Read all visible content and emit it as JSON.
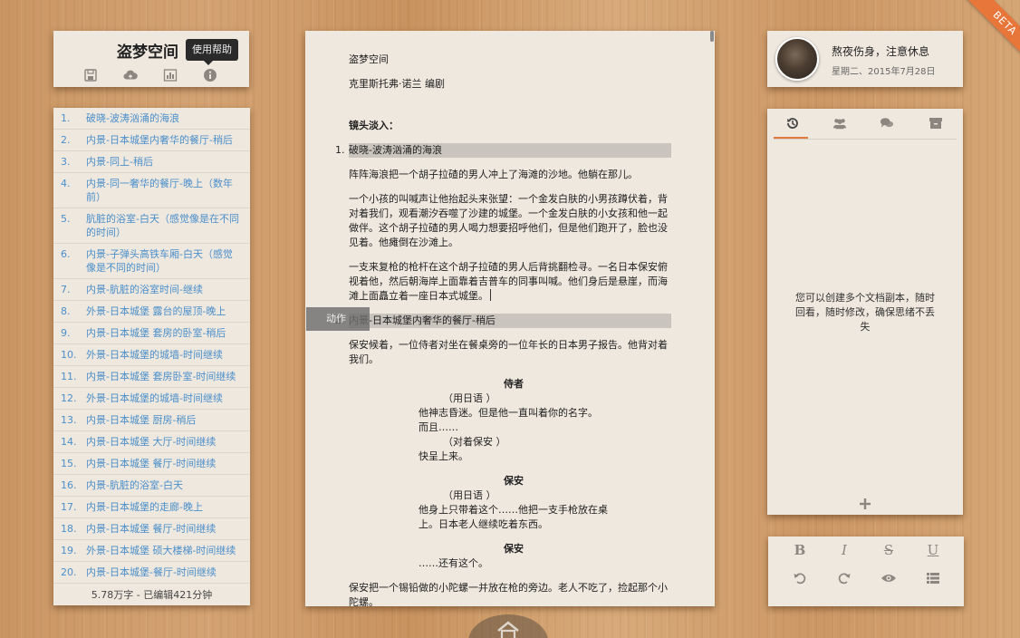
{
  "toolbar": {
    "app_title": "盗梦空间",
    "tooltip": "使用帮助",
    "icons": [
      "save-icon",
      "cloud-upload-icon",
      "chart-icon",
      "info-icon"
    ]
  },
  "scenes": [
    {
      "num": "1.",
      "text": "破晓-波涛汹涌的海浪"
    },
    {
      "num": "2.",
      "text": "内景-日本城堡内奢华的餐厅-稍后"
    },
    {
      "num": "3.",
      "text": "内景-同上-稍后"
    },
    {
      "num": "4.",
      "text": "内景-同一奢华的餐厅-晚上（数年前）"
    },
    {
      "num": "5.",
      "text": "肮脏的浴室-白天（感觉像是在不同的时间）"
    },
    {
      "num": "6.",
      "text": "内景-子弹头高铁车厢-白天（感觉像是不同的时间）"
    },
    {
      "num": "7.",
      "text": "内景-肮脏的浴室时间-继续"
    },
    {
      "num": "8.",
      "text": "外景-日本城堡 露台的屋顶-晚上"
    },
    {
      "num": "9.",
      "text": "内景-日本城堡 套房的卧室-稍后"
    },
    {
      "num": "10.",
      "text": "外景-日本城堡的城墙-时间继续"
    },
    {
      "num": "11.",
      "text": "内景-日本城堡 套房卧室-时间继续"
    },
    {
      "num": "12.",
      "text": "外景-日本城堡的城墙-时间继续"
    },
    {
      "num": "13.",
      "text": "内景-日本城堡 厨房-稍后"
    },
    {
      "num": "14.",
      "text": "内景-日本城堡 大厅-时间继续"
    },
    {
      "num": "15.",
      "text": "内景-日本城堡 餐厅-时间继续"
    },
    {
      "num": "16.",
      "text": "内景-肮脏的浴室-白天"
    },
    {
      "num": "17.",
      "text": "内景-日本城堡的走廊-晚上"
    },
    {
      "num": "18.",
      "text": "内景-日本城堡 餐厅-时间继续"
    },
    {
      "num": "19.",
      "text": "外景-日本城堡 硕大楼梯-时间继续"
    },
    {
      "num": "20.",
      "text": "内景-日本城堡-餐厅-时间继续"
    }
  ],
  "scene_footer": "5.78万字 - 已编辑421分钟",
  "doc": {
    "title": "盗梦空间",
    "author": "克里斯托弗·诺兰 编剧",
    "fade_in": "镜头淡入：",
    "scene1_num": "1.",
    "scene1_heading": "破晓-波涛汹涌的海浪",
    "action1": "阵阵海浪把一个胡子拉碴的男人冲上了海滩的沙地。他躺在那儿。",
    "action2": "一个小孩的叫喊声让他抬起头来张望：一个金发白肤的小男孩蹲伏着，背对着我们，观看潮汐吞噬了沙建的城堡。一个金发白肤的小女孩和他一起做伴。这个胡子拉碴的男人喝力想要招呼他们，但是他们跑开了，脸也没见着。他瘫倒在沙滩上。",
    "action3": "一支来复枪的枪杆在这个胡子拉碴的男人后背挑翻检寻。一名日本保安俯视着他，然后朝海岸上面靠着吉普车的同事叫喊。他们身后是悬崖，而海滩上面矗立着一座日本式城堡。",
    "scene2_num": "2.",
    "scene2_heading": "内景-日本城堡内奢华的餐厅-稍后",
    "action4": "保安候着，一位侍者对坐在餐桌旁的一位年长的日本男子报告。他背对着我们。",
    "char1": "侍者",
    "paren1": "（用日语 ）",
    "dlg1a": "他神志昏迷。但是他一直叫着你的名字。",
    "dlg1b": "而且……",
    "paren2": "（对着保安 ）",
    "dlg1c": "快呈上来。",
    "char2": "保安",
    "paren3": "（用日语 ）",
    "dlg2": "他身上只带着这个……他把一支手枪放在桌上。日本老人继续吃着东西。",
    "char3": "保安",
    "dlg3": "……还有这个。",
    "action5": "保安把一个锡铅做的小陀螺一并放在枪的旁边。老人不吃了，捡起那个小陀螺。"
  },
  "format_tab": "动作",
  "profile": {
    "status": "熬夜伤身，注意休息",
    "date": "星期二、2015年7月28日"
  },
  "panel": {
    "tabs": [
      "history-icon",
      "users-icon",
      "chat-icon",
      "archive-icon"
    ],
    "message": "您可以创建多个文档副本，随时回看，随时修改，确保思绪不丢失"
  },
  "format_toolbar": {
    "bold": "B",
    "italic": "I",
    "strike": "S",
    "underline": "U"
  },
  "beta_label": "BETA",
  "colors": {
    "accent": "#e07a3e",
    "link": "#4b8fca"
  }
}
